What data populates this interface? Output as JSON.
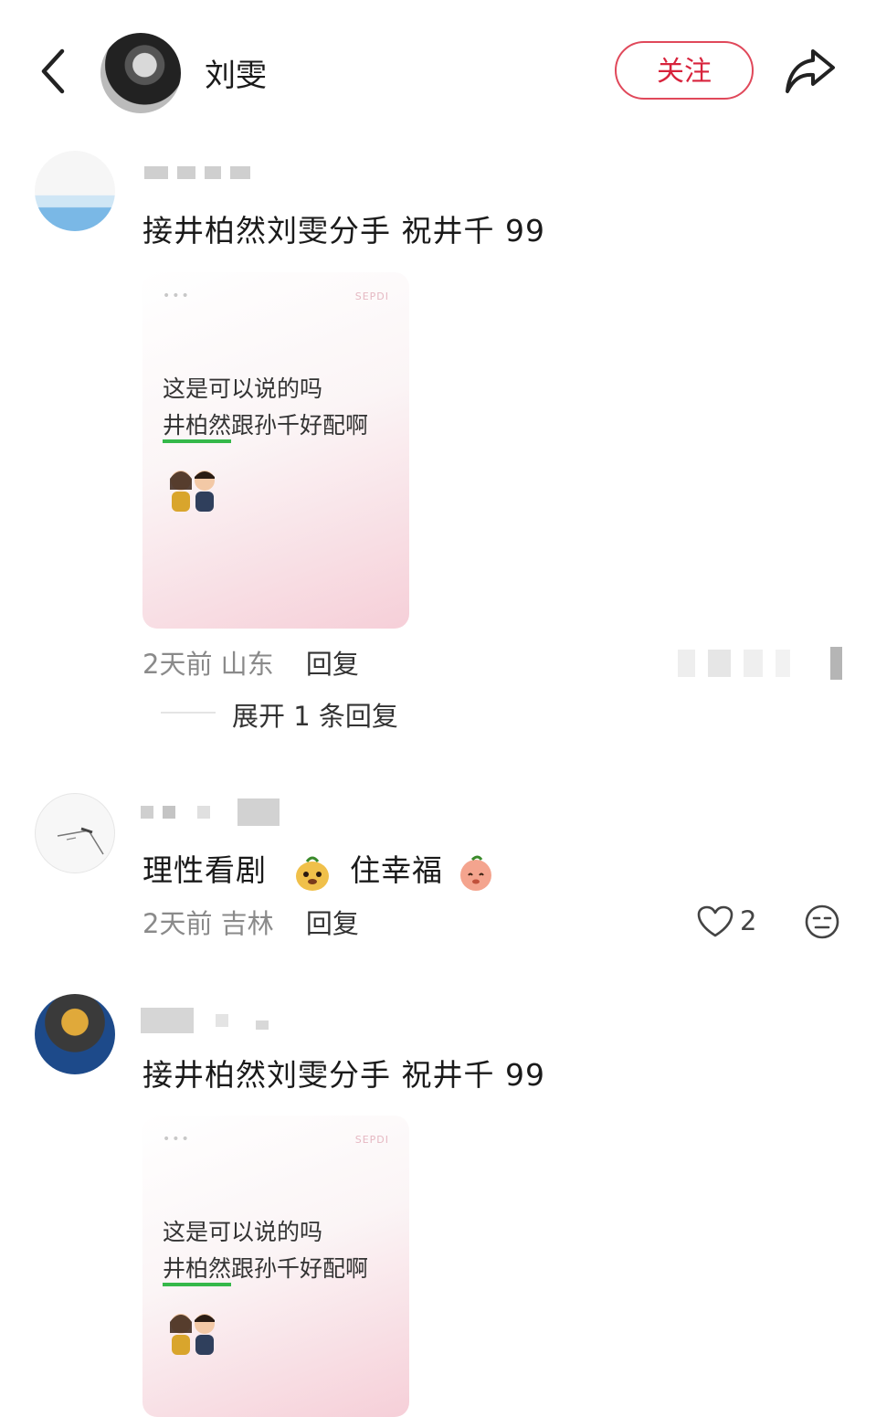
{
  "header": {
    "title": "刘雯",
    "follow_label": "关注"
  },
  "comments": [
    {
      "text": "接井柏然刘雯分手 祝井千 99",
      "card": {
        "dots": "•••",
        "mark": "SEPDI",
        "line1": "这是可以说的吗",
        "line2_highlight": "井柏然",
        "line2_rest": "跟孙千好配啊"
      },
      "time": "2天前",
      "location": "山东",
      "reply_label": "回复",
      "expand_label": "展开 1 条回复"
    },
    {
      "text_a": "理性看剧",
      "text_b": "住幸福",
      "time": "2天前",
      "location": "吉林",
      "reply_label": "回复",
      "like_count": "2"
    },
    {
      "text": "接井柏然刘雯分手 祝井千 99",
      "card": {
        "dots": "•••",
        "mark": "SEPDI",
        "line1": "这是可以说的吗",
        "line2_highlight": "井柏然",
        "line2_rest": "跟孙千好配啊"
      }
    }
  ],
  "colors": {
    "accent": "#d8233c",
    "highlight": "#35b84a"
  }
}
